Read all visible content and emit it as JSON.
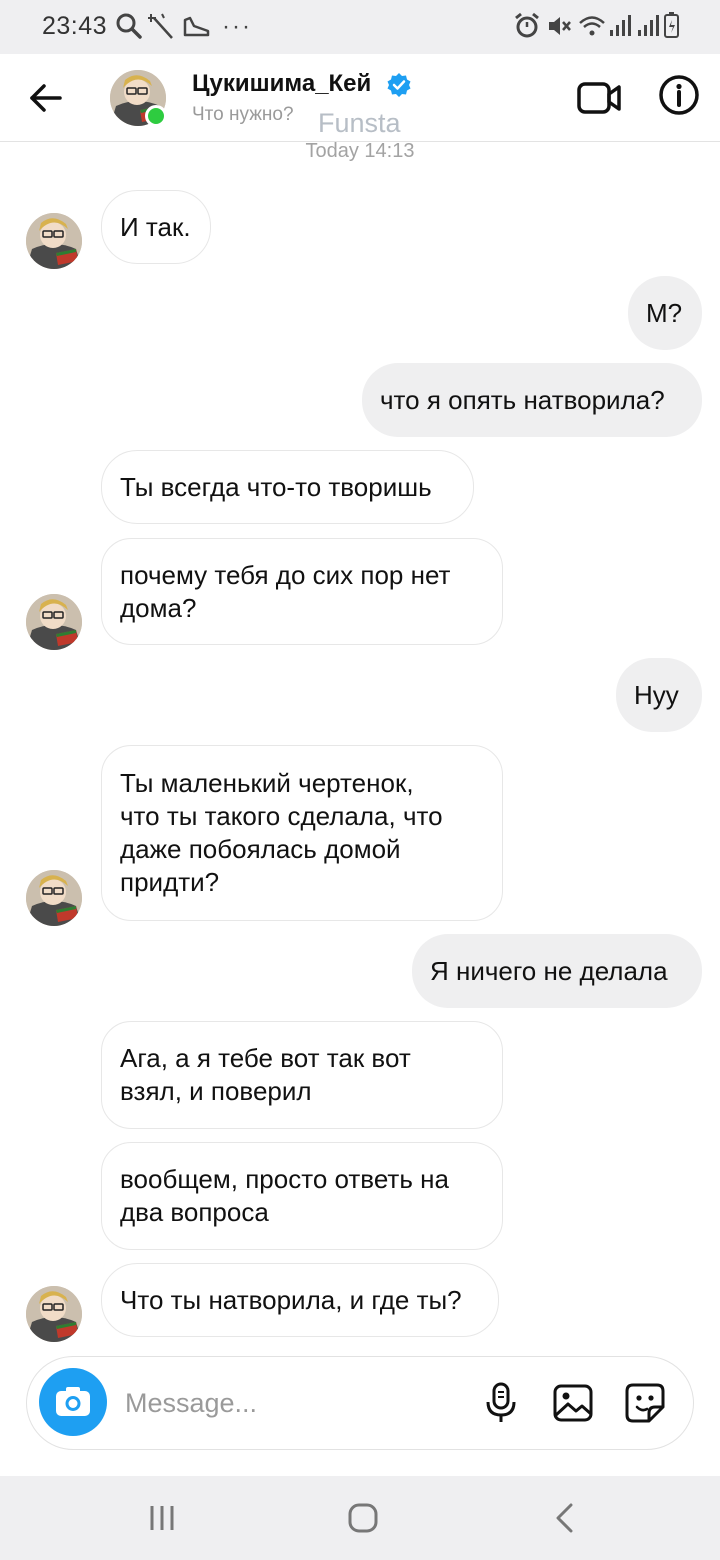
{
  "status_bar": {
    "time": "23:43",
    "left_icons": [
      "search-icon",
      "magic-wand-icon",
      "shoe-icon"
    ],
    "more": "···",
    "right_icons": [
      "alarm-icon",
      "mute-icon",
      "wifi-icon",
      "signal-icon",
      "signal-icon",
      "battery-icon"
    ]
  },
  "header": {
    "name": "Цукишима_Кей",
    "status": "Что нужно?",
    "verified": true,
    "online": true
  },
  "watermark": "Funsta",
  "day_stamp": "Today 14:13",
  "messages": [
    {
      "dir": "in",
      "lines": [
        "И так."
      ],
      "avatar": true
    },
    {
      "dir": "out",
      "lines": [
        "М?"
      ]
    },
    {
      "dir": "out",
      "lines": [
        "что я опять натворила?"
      ]
    },
    {
      "dir": "in",
      "lines": [
        "Ты всегда что-то творишь"
      ],
      "avatar": false
    },
    {
      "dir": "in",
      "lines": [
        "почему тебя до сих пор нет",
        "дома?"
      ],
      "avatar": true
    },
    {
      "dir": "out",
      "lines": [
        "Нуу"
      ]
    },
    {
      "dir": "in",
      "lines": [
        "Ты маленький чертенок,",
        "что ты такого сделала, что",
        "даже побоялась домой",
        "придти?"
      ],
      "avatar": true
    },
    {
      "dir": "out",
      "lines": [
        "Я ничего не делала"
      ]
    },
    {
      "dir": "in",
      "lines": [
        "Ага, а я тебе вот так вот",
        "взял, и поверил"
      ],
      "avatar": false
    },
    {
      "dir": "in",
      "lines": [
        "вообщем, просто ответь на",
        "два вопроса"
      ],
      "avatar": false
    },
    {
      "dir": "in",
      "lines": [
        "Что ты натворила, и где ты?"
      ],
      "avatar": true
    }
  ],
  "composer": {
    "placeholder": "Message..."
  },
  "colors": {
    "accent": "#1e9ff2",
    "online": "#2ecc40",
    "outgoing_bubble": "#efeff0",
    "incoming_border": "#e7e7e7"
  }
}
